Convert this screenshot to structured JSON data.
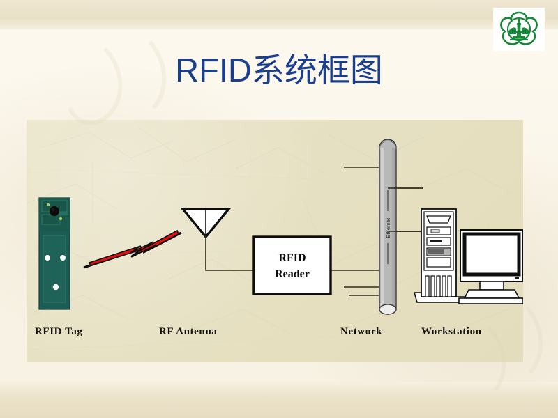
{
  "slide": {
    "title": "RFID系统框图",
    "title_color": "#1b3f8f",
    "background_color": "#fbf6e9",
    "panel_color": "#e7e1c4"
  },
  "logo": {
    "name": "institution-emblem",
    "color": "#18893b",
    "description": "green quatrefoil emblem with pagoda tower"
  },
  "diagram": {
    "type": "block-diagram",
    "nodes": [
      {
        "id": "rfid-tag",
        "label": "RFID Tag",
        "shape": "pcb-tag",
        "color": "#1d5d55"
      },
      {
        "id": "rf-antenna",
        "label": "RF Antenna",
        "shape": "triangle-antenna",
        "color": "#ffffff"
      },
      {
        "id": "rfid-reader",
        "label": "RFID\nReader",
        "label_line1": "RFID",
        "label_line2": "Reader",
        "shape": "rectangle",
        "color": "#ffffff"
      },
      {
        "id": "network",
        "label": "Network",
        "shape": "backbone-cylinder",
        "color": "#b6b6b6",
        "annotation": "Ethernet"
      },
      {
        "id": "workstation",
        "label": "Workstation",
        "shape": "tower-pc-and-monitor",
        "color": "#ffffff"
      }
    ],
    "links": [
      {
        "from": "rfid-tag",
        "to": "rf-antenna",
        "style": "rf-lightning",
        "color": "#e11010"
      },
      {
        "from": "rf-antenna",
        "to": "rfid-reader",
        "style": "wire"
      },
      {
        "from": "rfid-reader",
        "to": "network",
        "style": "wire"
      },
      {
        "from": "network",
        "to": "workstation",
        "style": "wire"
      }
    ]
  }
}
